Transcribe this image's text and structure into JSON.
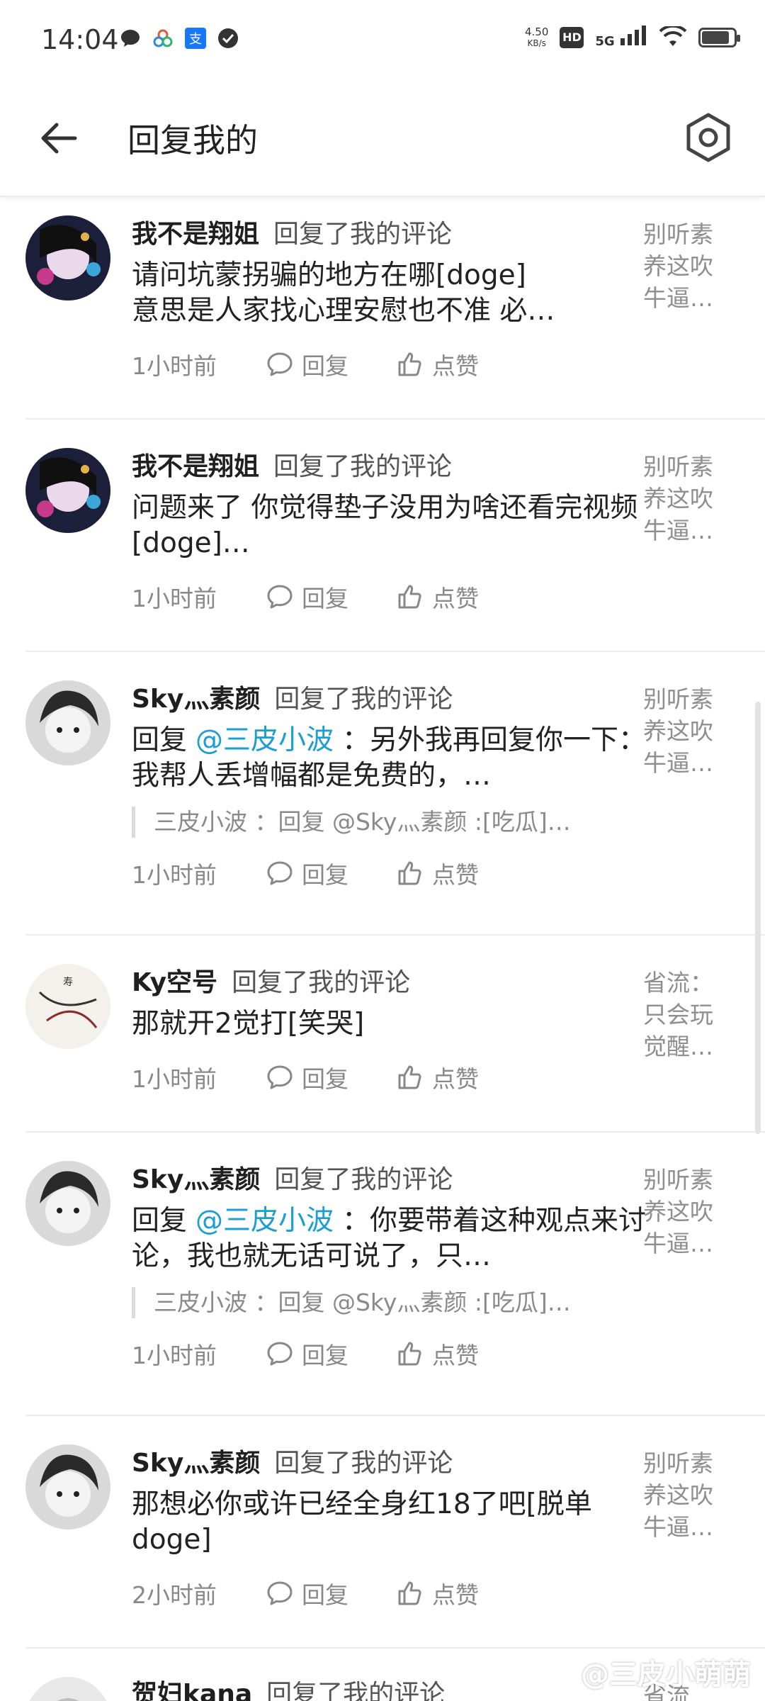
{
  "status_bar": {
    "time": "14:04",
    "net_speed_value": "4.50",
    "net_speed_unit": "KB/s",
    "hd_label": "HD",
    "signal_label": "5G"
  },
  "header": {
    "title": "回复我的"
  },
  "items": [
    {
      "username": "我不是翔姐",
      "action": "回复了我的评论",
      "text": "请问坑蒙拐骗的地方在哪[doge]\n意思是人家找心理安慰也不准  必…",
      "time": "1小时前",
      "reply_label": "回复",
      "like_label": "点赞",
      "original": "别听素养这吹牛逼…"
    },
    {
      "username": "我不是翔姐",
      "action": "回复了我的评论",
      "text": "问题来了  你觉得垫子没用为啥还看完视频[doge]…",
      "time": "1小时前",
      "reply_label": "回复",
      "like_label": "点赞",
      "original": "别听素养这吹牛逼…"
    },
    {
      "username": "Sky灬素颜",
      "action": "回复了我的评论",
      "text_prefix": "回复",
      "mention": "@三皮小波",
      "text": "：另外我再回复你一下：我帮人丢增幅都是免费的，…",
      "quote": "三皮小波 ：回复 @Sky灬素颜 :[吃瓜]…",
      "time": "1小时前",
      "reply_label": "回复",
      "like_label": "点赞",
      "original": "别听素养这吹牛逼…"
    },
    {
      "username": "Ky空号",
      "action": "回复了我的评论",
      "text": "那就开2觉打[笑哭]",
      "time": "1小时前",
      "reply_label": "回复",
      "like_label": "点赞",
      "original": "省流：只会玩觉醒…"
    },
    {
      "username": "Sky灬素颜",
      "action": "回复了我的评论",
      "text_prefix": "回复",
      "mention": "@三皮小波",
      "text": "：你要带着这种观点来讨论，我也就无话可说了，只…",
      "quote": "三皮小波 ：回复 @Sky灬素颜 :[吃瓜]…",
      "time": "1小时前",
      "reply_label": "回复",
      "like_label": "点赞",
      "original": "别听素养这吹牛逼…"
    },
    {
      "username": "Sky灬素颜",
      "action": "回复了我的评论",
      "text": "那想必你或许已经全身红18了吧[脱单doge]",
      "time": "2小时前",
      "reply_label": "回复",
      "like_label": "点赞",
      "original": "别听素养这吹牛逼…"
    },
    {
      "username": "贺妇kana",
      "action": "回复了我的评论",
      "text": "",
      "time": "",
      "reply_label": "",
      "like_label": "",
      "original": "省流"
    }
  ],
  "watermark": "@三皮小萌萌",
  "colors": {
    "accent": "#1a9ed4",
    "text": "#1f1f1f",
    "muted": "#888888"
  }
}
